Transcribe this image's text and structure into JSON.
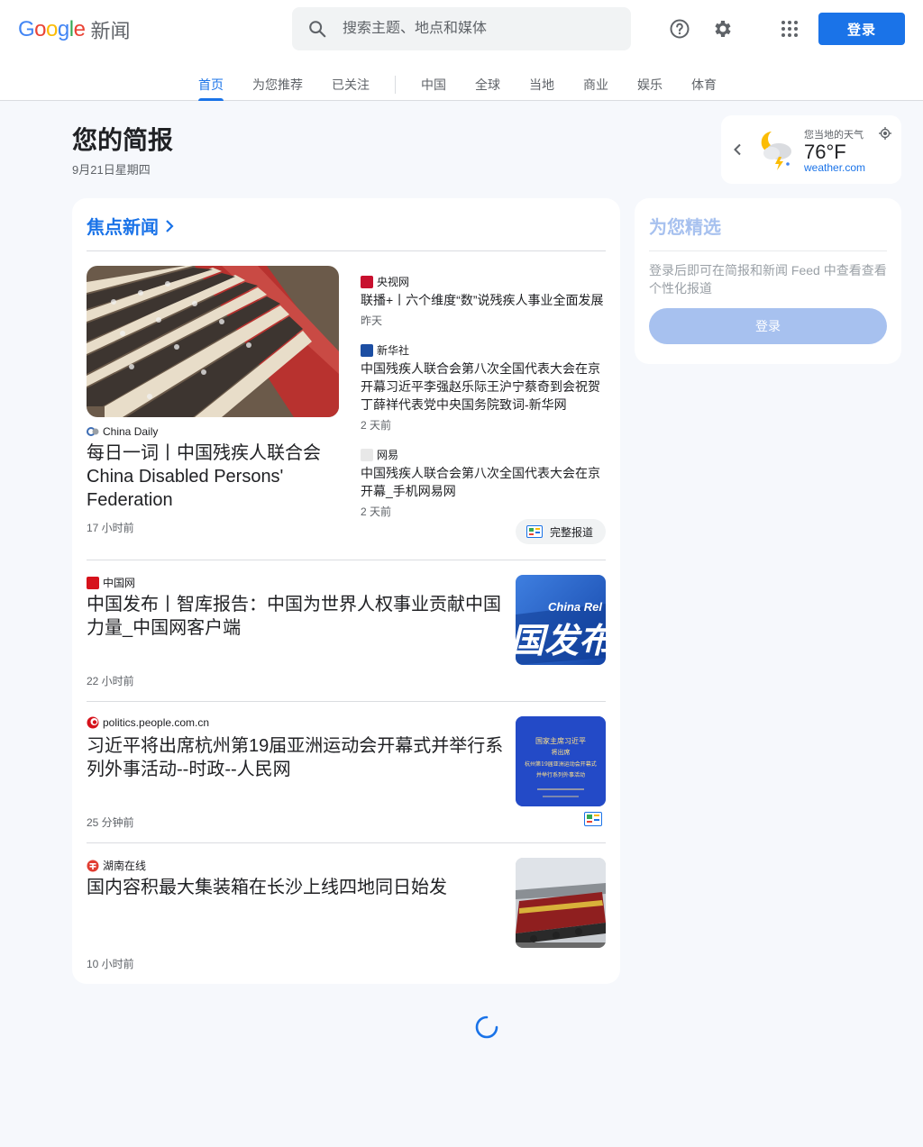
{
  "header": {
    "logo_letters": [
      "G",
      "o",
      "o",
      "g",
      "l",
      "e"
    ],
    "product_name": "新闻",
    "search_placeholder": "搜索主题、地点和媒体",
    "signin_label": "登录",
    "icons": [
      "search-icon",
      "help-icon",
      "settings-icon",
      "apps-grid-icon"
    ]
  },
  "nav": {
    "tabs": [
      {
        "label": "首页",
        "active": true
      },
      {
        "label": "为您推荐",
        "active": false
      },
      {
        "label": "已关注",
        "active": false
      },
      {
        "label": "中国",
        "active": false
      },
      {
        "label": "全球",
        "active": false
      },
      {
        "label": "当地",
        "active": false
      },
      {
        "label": "商业",
        "active": false
      },
      {
        "label": "娱乐",
        "active": false
      },
      {
        "label": "体育",
        "active": false
      }
    ]
  },
  "briefing": {
    "title": "您的简报",
    "date": "9月21日星期四"
  },
  "weather": {
    "label": "您当地的天气",
    "temperature": "76°F",
    "source": "weather.com",
    "icon": "partly-cloudy-night-thunder-icon"
  },
  "top_stories": {
    "heading": "焦点新闻",
    "lead": {
      "publisher": "China Daily",
      "title": "每日一词丨中国残疾人联合会 China Disabled Persons' Federation",
      "time": "17 小时前"
    },
    "side": [
      {
        "publisher": "央视网",
        "title": "联播+丨六个维度“数”说残疾人事业全面发展",
        "time": "昨天"
      },
      {
        "publisher": "新华社",
        "title": "中国残疾人联合会第八次全国代表大会在京开幕习近平李强赵乐际王沪宁蔡奇到会祝贺 丁薛祥代表党中央国务院致词-新华网",
        "time": "2 天前"
      },
      {
        "publisher": "网易",
        "title": "中国残疾人联合会第八次全国代表大会在京开幕_手机网易网",
        "time": "2 天前"
      }
    ],
    "full_coverage_label": "完整报道",
    "rows": [
      {
        "publisher": "中国网",
        "title": "中国发布丨智库报告：中国为世界人权事业贡献中国力量_中国网客户端",
        "time": "22 小时前",
        "image_text": "China Rel 发布",
        "has_coverage": false
      },
      {
        "publisher": "politics.people.com.cn",
        "title": "习近平将出席杭州第19届亚洲运动会开幕式并举行系列外事活动--时政--人民网",
        "time": "25 分钟前",
        "image_lines": [
          "国家主席习近平",
          "将出席",
          "杭州第19届亚洲运动会开幕式",
          "并举行系列外事活动"
        ],
        "has_coverage": true
      },
      {
        "publisher": "湖南在线",
        "title": "国内容积最大集装箱在长沙上线四地同日始发",
        "time": "10 小时前",
        "has_coverage": false
      }
    ]
  },
  "picks": {
    "title": "为您精选",
    "description": "登录后即可在简报和新闻 Feed 中查看查看个性化报道",
    "button_label": "登录"
  },
  "colors": {
    "accent": "#1a73e8",
    "background": "#f6f8fc",
    "disabled_accent": "#a7c1ef"
  }
}
